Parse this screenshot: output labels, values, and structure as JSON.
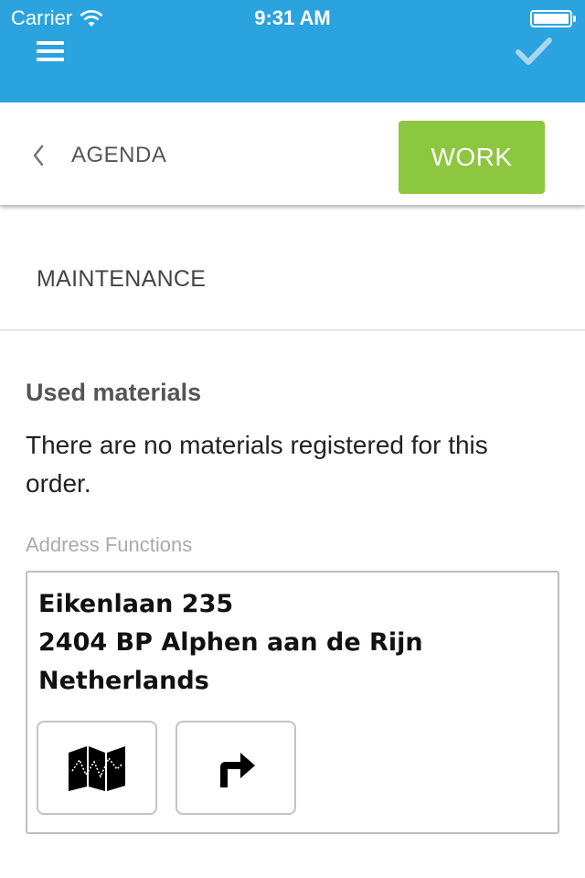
{
  "status_bar": {
    "carrier": "Carrier",
    "time": "9:31 AM"
  },
  "colors": {
    "header_blue": "#2aa3df",
    "work_green": "#8dc63f"
  },
  "toolbar": {
    "menu_icon": "hamburger-menu-icon",
    "confirm_icon": "checkmark-icon"
  },
  "nav": {
    "back_label": "AGENDA",
    "work_button": "WORK"
  },
  "section": {
    "title": "MAINTENANCE"
  },
  "materials": {
    "heading": "Used materials",
    "message": "There are no materials registered for this order."
  },
  "address": {
    "label": "Address Functions",
    "line1": "Eikenlaan 235",
    "line2": "2404 BP Alphen aan de Rijn",
    "line3": "Netherlands",
    "map_button_icon": "map-icon",
    "route_button_icon": "directions-icon"
  }
}
